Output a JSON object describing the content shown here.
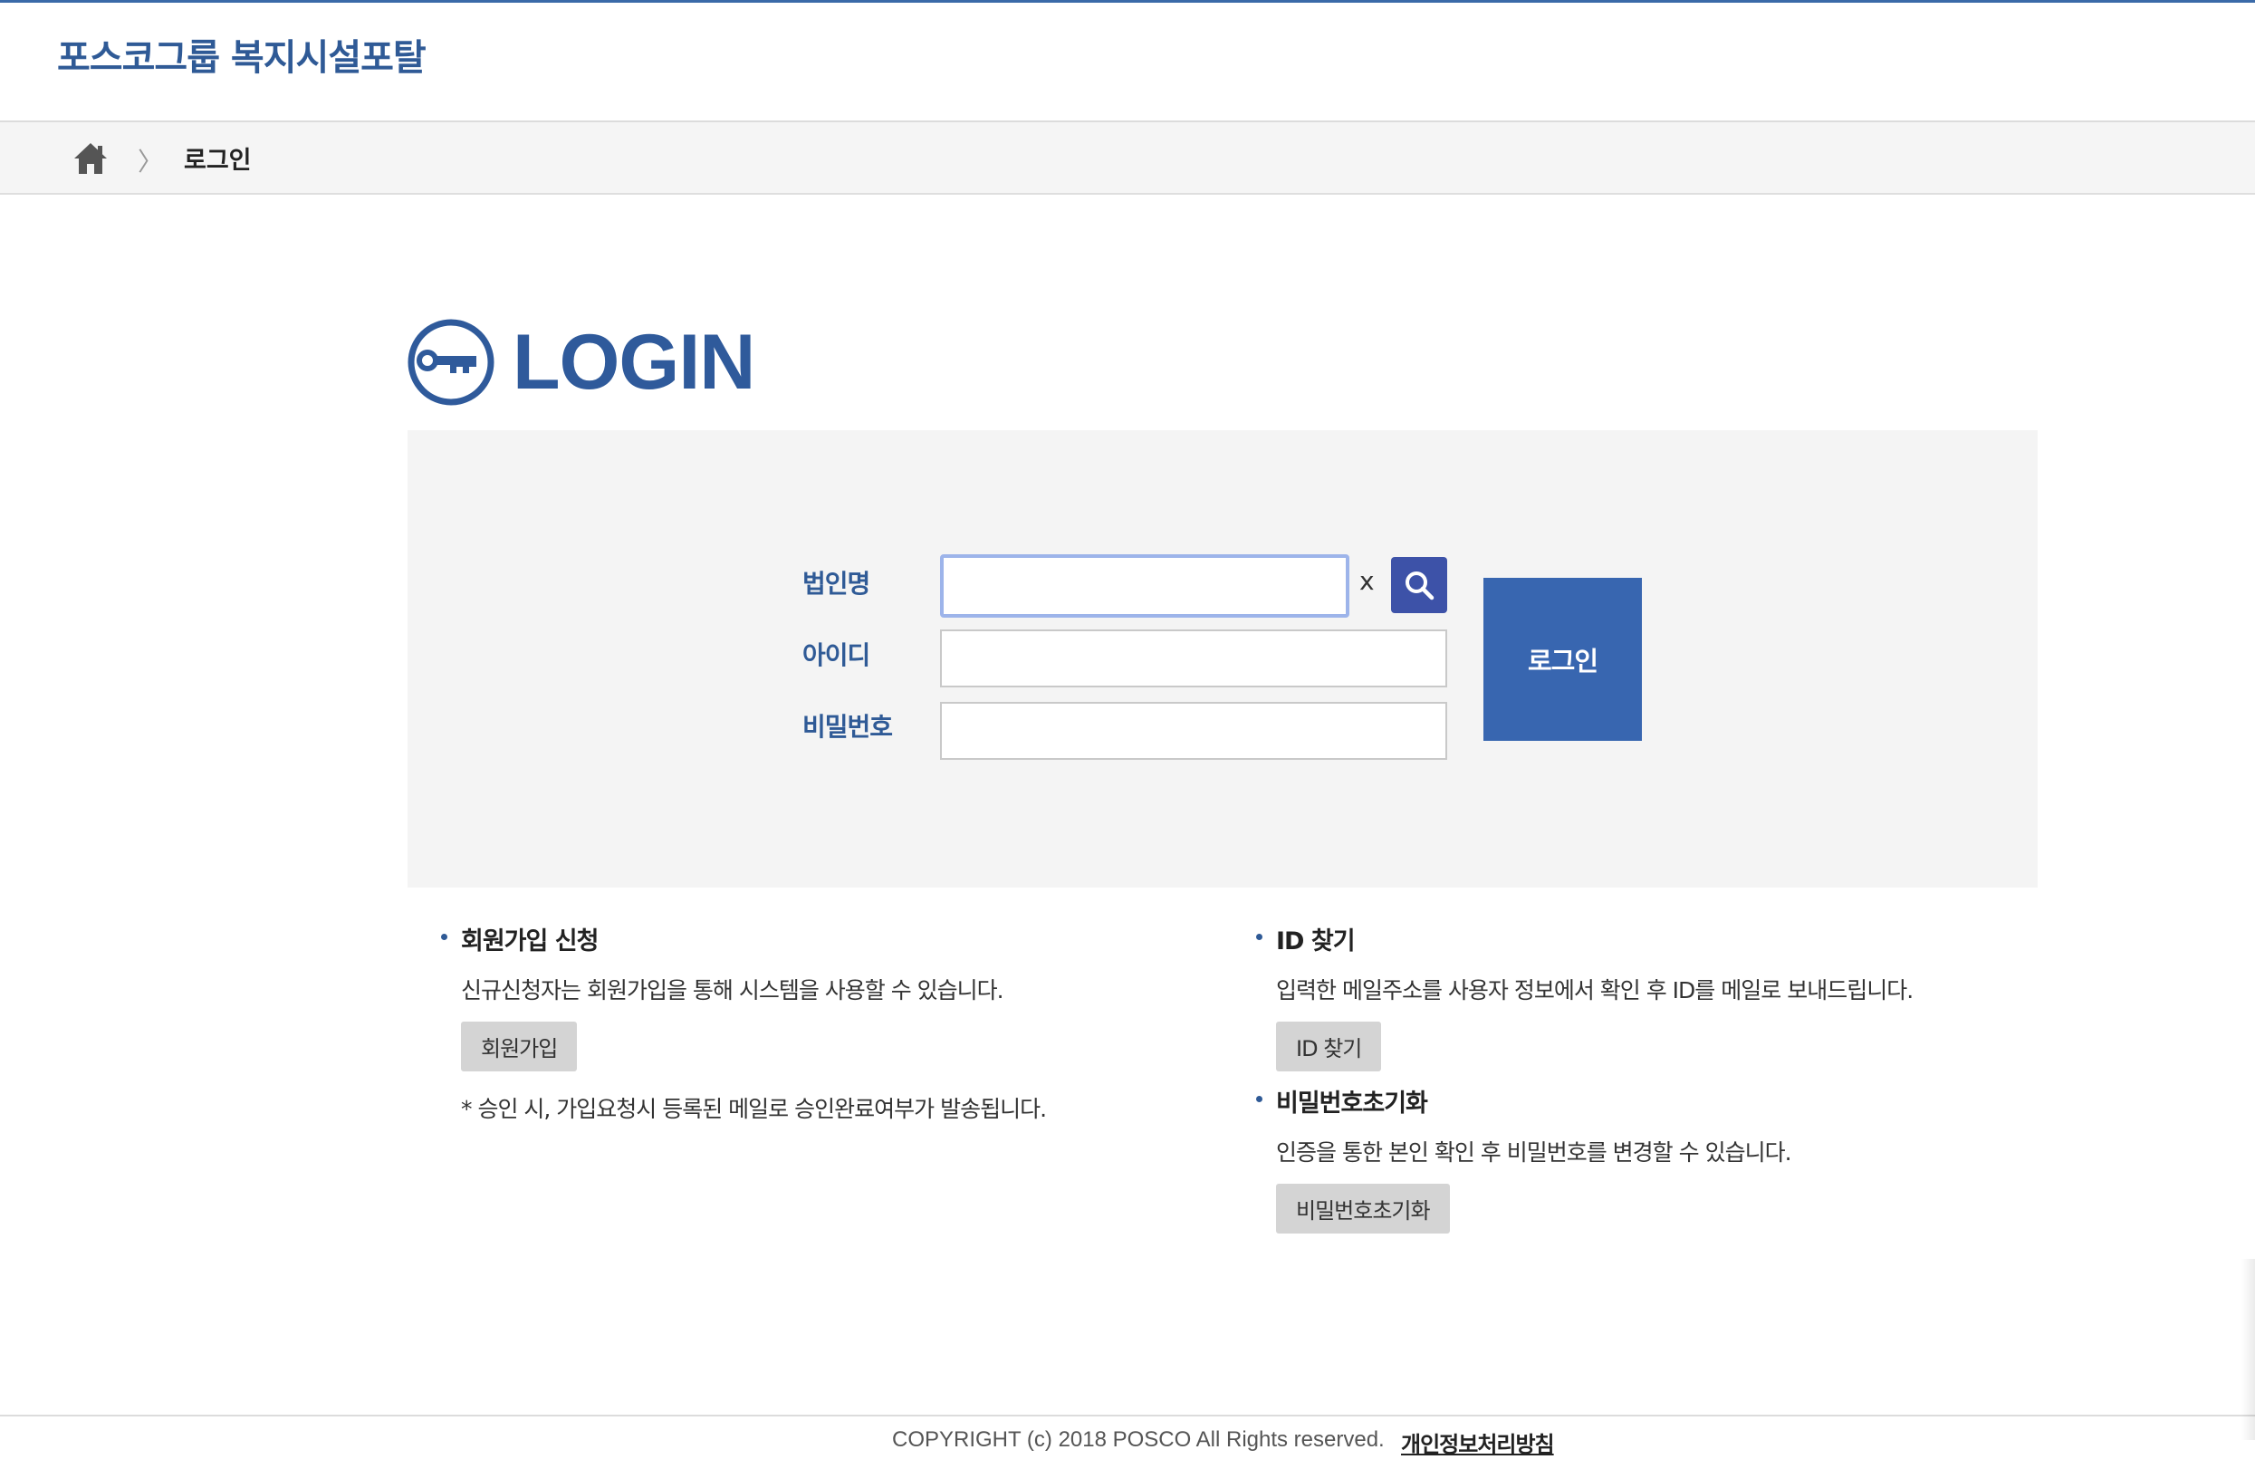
{
  "header": {
    "site_title": "포스코그룹 복지시설포탈"
  },
  "breadcrumb": {
    "home_icon": "home-icon",
    "separator": "〉",
    "current": "로그인"
  },
  "login": {
    "title": "LOGIN",
    "icon": "key-icon",
    "fields": {
      "corp_label": "법인명",
      "corp_value": "",
      "corp_clear": "x",
      "id_label": "아이디",
      "id_value": "",
      "password_label": "비밀번호",
      "password_value": ""
    },
    "submit_label": "로그인"
  },
  "join": {
    "heading": "회원가입 신청",
    "description": "신규신청자는 회원가입을 통해 시스템을 사용할 수 있습니다.",
    "button": "회원가입",
    "note": "* 승인 시, 가입요청시 등록된 메일로 승인완료여부가 발송됩니다."
  },
  "find_id": {
    "heading": "ID 찾기",
    "description": "입력한 메일주소를 사용자 정보에서 확인 후 ID를 메일로 보내드립니다.",
    "button": "ID 찾기"
  },
  "reset_password": {
    "heading": "비밀번호초기화",
    "description": "인증을 통한 본인 확인 후 비밀번호를 변경할 수 있습니다.",
    "button": "비밀번호초기화"
  },
  "footer": {
    "copyright": "COPYRIGHT (c) 2018 POSCO All Rights reserved.",
    "privacy": "개인정보처리방침"
  },
  "colors": {
    "brand": "#2f5a96",
    "login_button": "#3866b0",
    "search_button": "#3d52a8",
    "panel": "#f4f4f4"
  }
}
